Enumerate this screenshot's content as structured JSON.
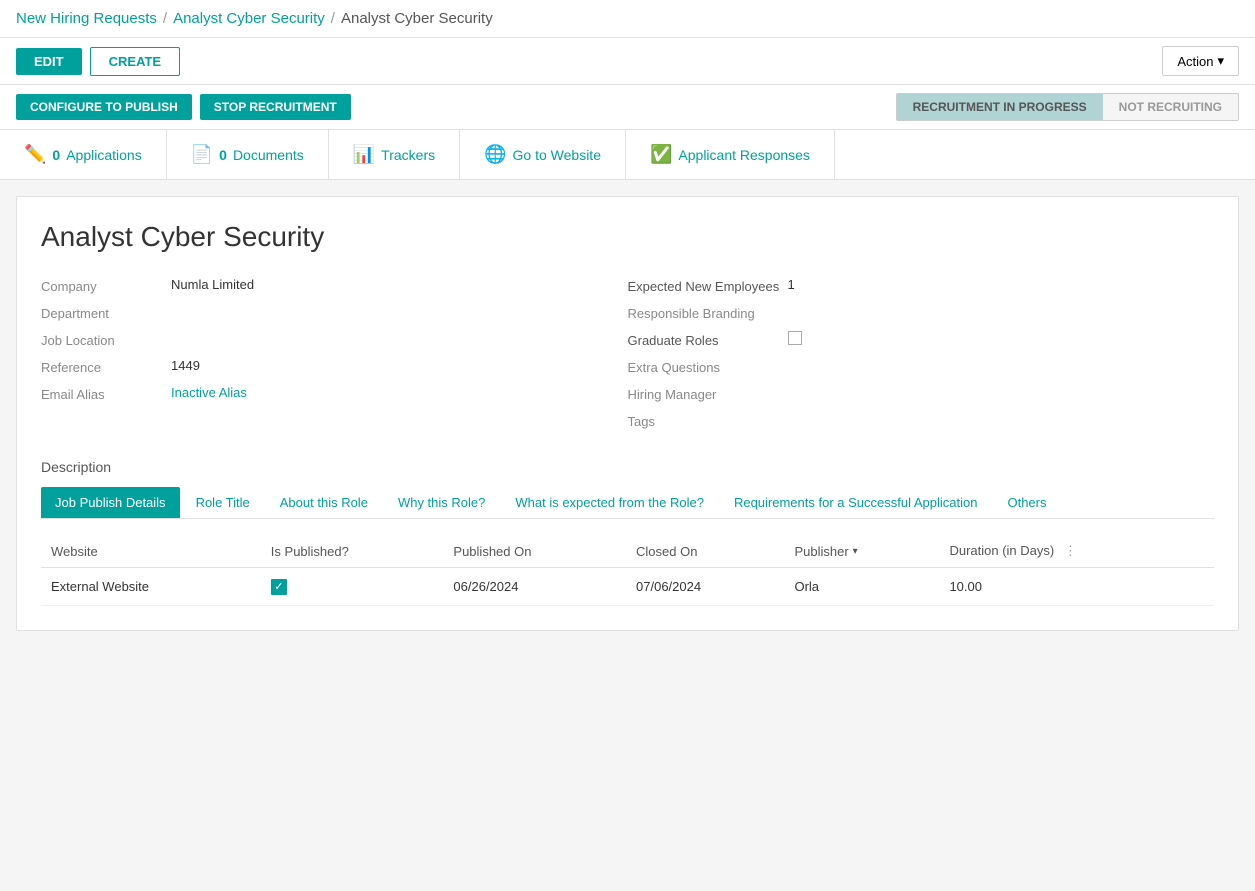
{
  "breadcrumb": {
    "items": [
      {
        "label": "New Hiring Requests",
        "link": true
      },
      {
        "label": "Analyst Cyber Security",
        "link": true
      },
      {
        "label": "Analyst Cyber Security",
        "link": false
      }
    ]
  },
  "toolbar": {
    "edit_label": "EDIT",
    "create_label": "CREATE",
    "action_label": "Action"
  },
  "publish_bar": {
    "configure_label": "CONFIGURE TO PUBLISH",
    "stop_label": "STOP RECRUITMENT",
    "status_active": "RECRUITMENT IN PROGRESS",
    "status_inactive": "NOT RECRUITING"
  },
  "tabs": [
    {
      "icon": "✏️",
      "count": "0",
      "label": "Applications"
    },
    {
      "icon": "📄",
      "count": "0",
      "label": "Documents"
    },
    {
      "icon": "📊",
      "label": "Trackers"
    },
    {
      "icon": "🌐",
      "label": "Go to Website"
    },
    {
      "icon": "✅",
      "label": "Applicant Responses"
    }
  ],
  "job": {
    "title": "Analyst Cyber Security",
    "fields_left": [
      {
        "label": "Company",
        "value": "Numla Limited",
        "type": "text"
      },
      {
        "label": "Department",
        "value": "",
        "type": "text"
      },
      {
        "label": "Job Location",
        "value": "",
        "type": "text"
      },
      {
        "label": "Reference",
        "value": "1449",
        "type": "text"
      },
      {
        "label": "Email Alias",
        "value": "Inactive Alias",
        "type": "link"
      }
    ],
    "fields_right": [
      {
        "label": "Expected New Employees",
        "value": "1",
        "type": "text"
      },
      {
        "label": "Responsible Branding",
        "value": "",
        "type": "text"
      },
      {
        "label": "Graduate Roles",
        "value": "",
        "type": "checkbox"
      },
      {
        "label": "Extra Questions",
        "value": "",
        "type": "text"
      },
      {
        "label": "Hiring Manager",
        "value": "",
        "type": "text"
      },
      {
        "label": "Tags",
        "value": "",
        "type": "text"
      }
    ]
  },
  "description_label": "Description",
  "inner_tabs": [
    {
      "label": "Job Publish Details",
      "active": true
    },
    {
      "label": "Role Title",
      "active": false
    },
    {
      "label": "About this Role",
      "active": false
    },
    {
      "label": "Why this Role?",
      "active": false
    },
    {
      "label": "What is expected from the Role?",
      "active": false
    },
    {
      "label": "Requirements for a Successful Application",
      "active": false
    },
    {
      "label": "Others",
      "active": false
    }
  ],
  "table": {
    "columns": [
      "Website",
      "Is Published?",
      "Published On",
      "Closed On",
      "Publisher",
      "Duration (in Days)"
    ],
    "rows": [
      {
        "website": "External Website",
        "is_published": true,
        "published_on": "06/26/2024",
        "closed_on": "07/06/2024",
        "publisher": "Orla",
        "duration": "10.00"
      }
    ]
  }
}
